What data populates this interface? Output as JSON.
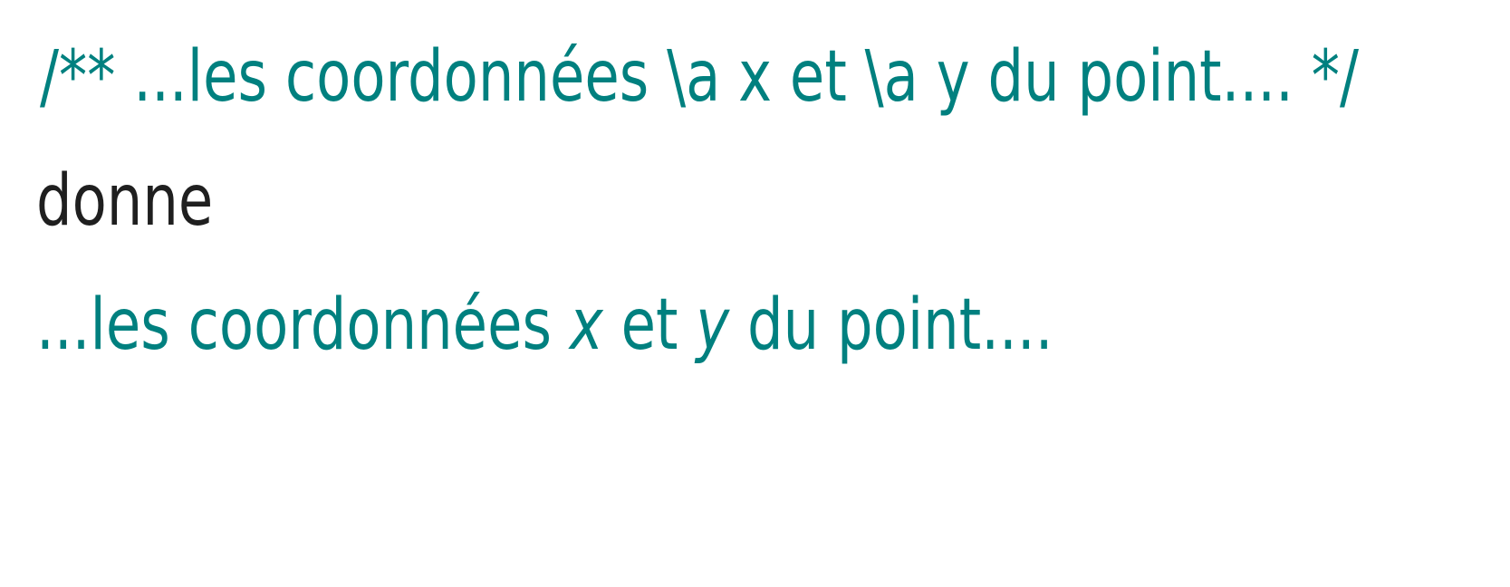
{
  "source_comment": {
    "text": "/** ...les coordonnées \\a x et \\a y du point.... */",
    "color": "#00807f"
  },
  "connector": {
    "text": "donne",
    "color": "#1f1f1f"
  },
  "rendered_output": {
    "part1": "...les coordonnées ",
    "var_x": "x",
    "part2": " et ",
    "var_y": "y",
    "part3": " du point....",
    "color": "#00807f"
  }
}
